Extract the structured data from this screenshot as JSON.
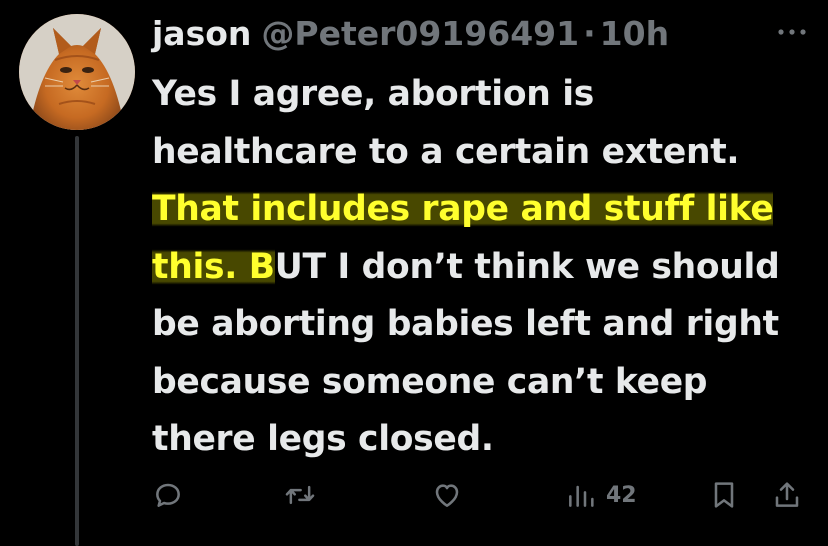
{
  "tweet": {
    "display_name": "jason",
    "handle": "@Peter09196491",
    "separator": "·",
    "time": "10h",
    "text_lines": [
      "Yes I agree, abortion is",
      "healthcare to a certain extent.",
      "That includes rape and stuff like",
      "this. B",
      "UT I don’t think we should",
      "be aborting babies left and right",
      "because someone can’t keep",
      "there legs closed."
    ],
    "highlight_color": "#ffff2e"
  },
  "actions": {
    "reply_icon": "reply-icon",
    "retweet_icon": "retweet-icon",
    "like_icon": "like-icon",
    "views_icon": "views-icon",
    "views_count": "42",
    "bookmark_icon": "bookmark-icon",
    "share_icon": "share-icon"
  },
  "colors": {
    "background": "#000000",
    "text": "#e7e9ea",
    "muted": "#71767b",
    "thread_line": "#333639"
  }
}
